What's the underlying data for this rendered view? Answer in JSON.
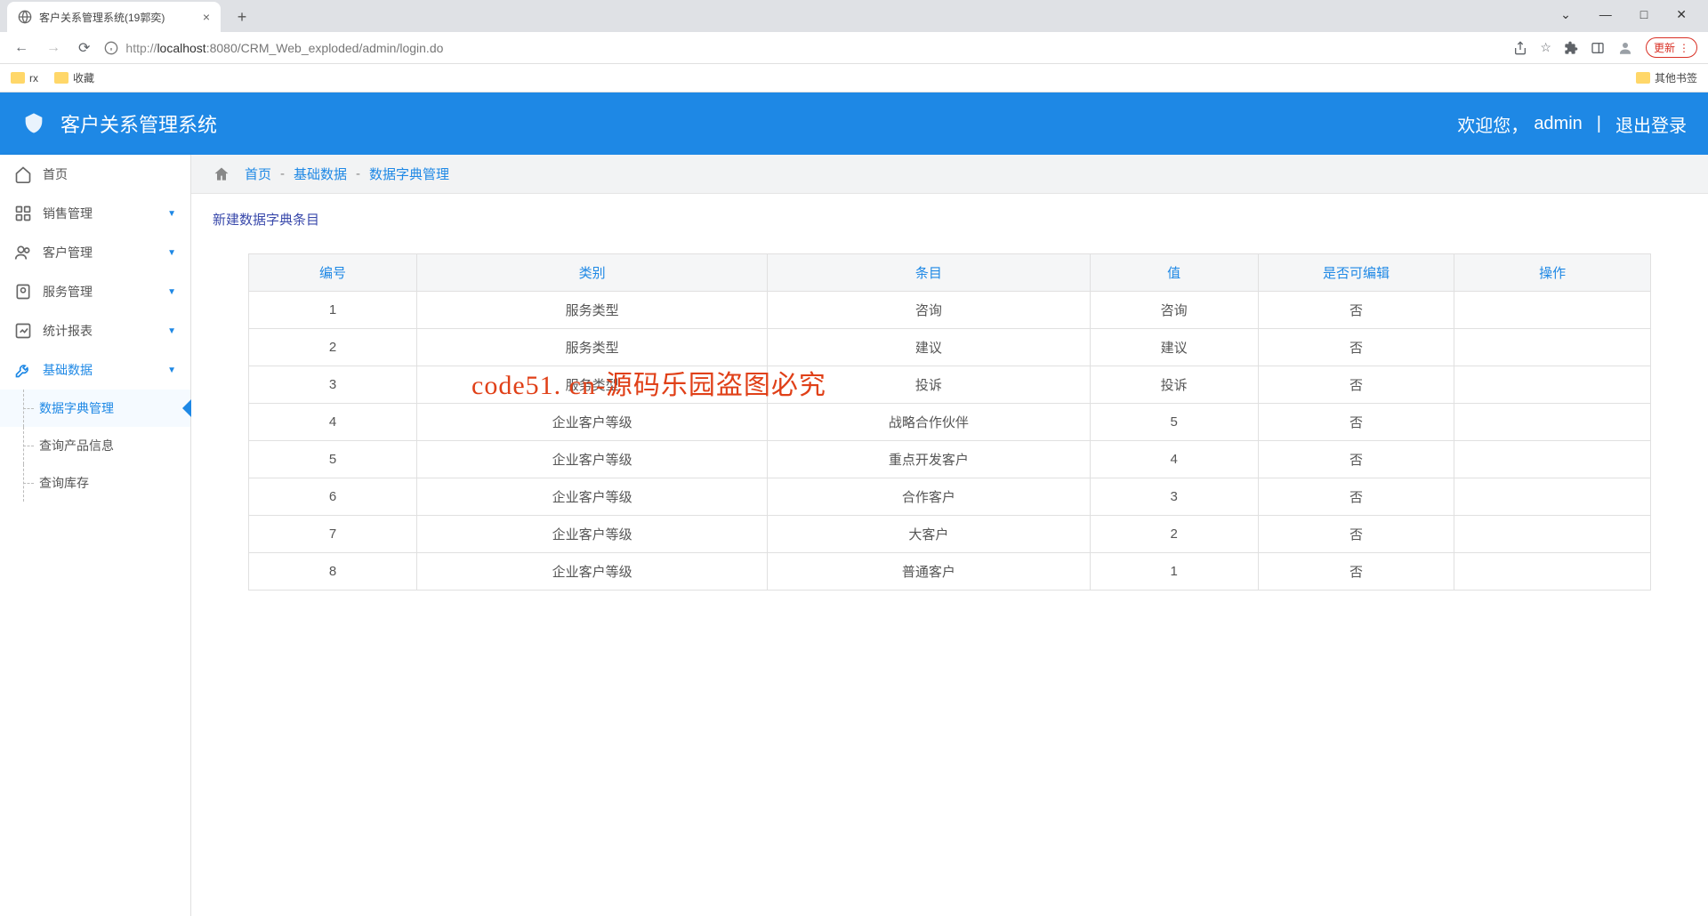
{
  "browser": {
    "tab_title": "客户关系管理系统(19郭奕)",
    "url_proto": "http://",
    "url_host": "localhost",
    "url_port_path": ":8080/CRM_Web_exploded/admin/login.do",
    "update_label": "更新",
    "bookmarks": {
      "rx": "rx",
      "fav": "收藏",
      "other": "其他书签"
    }
  },
  "header": {
    "title": "客户关系管理系统",
    "welcome": "欢迎您，",
    "user": "admin",
    "logout": "退出登录"
  },
  "sidebar": {
    "home": "首页",
    "sales": "销售管理",
    "customer": "客户管理",
    "service": "服务管理",
    "report": "统计报表",
    "basicdata": "基础数据",
    "sub": {
      "dict": "数据字典管理",
      "product": "查询产品信息",
      "stock": "查询库存"
    }
  },
  "breadcrumb": {
    "home": "首页",
    "basic": "基础数据",
    "dict": "数据字典管理"
  },
  "content": {
    "new_link": "新建数据字典条目",
    "columns": {
      "id": "编号",
      "type": "类别",
      "item": "条目",
      "value": "值",
      "editable": "是否可编辑",
      "action": "操作"
    },
    "rows": [
      {
        "id": "1",
        "type": "服务类型",
        "item": "咨询",
        "value": "咨询",
        "editable": "否"
      },
      {
        "id": "2",
        "type": "服务类型",
        "item": "建议",
        "value": "建议",
        "editable": "否"
      },
      {
        "id": "3",
        "type": "服务类型",
        "item": "投诉",
        "value": "投诉",
        "editable": "否"
      },
      {
        "id": "4",
        "type": "企业客户等级",
        "item": "战略合作伙伴",
        "value": "5",
        "editable": "否"
      },
      {
        "id": "5",
        "type": "企业客户等级",
        "item": "重点开发客户",
        "value": "4",
        "editable": "否"
      },
      {
        "id": "6",
        "type": "企业客户等级",
        "item": "合作客户",
        "value": "3",
        "editable": "否"
      },
      {
        "id": "7",
        "type": "企业客户等级",
        "item": "大客户",
        "value": "2",
        "editable": "否"
      },
      {
        "id": "8",
        "type": "企业客户等级",
        "item": "普通客户",
        "value": "1",
        "editable": "否"
      }
    ]
  },
  "watermark": "code51. cn-源码乐园盗图必究"
}
